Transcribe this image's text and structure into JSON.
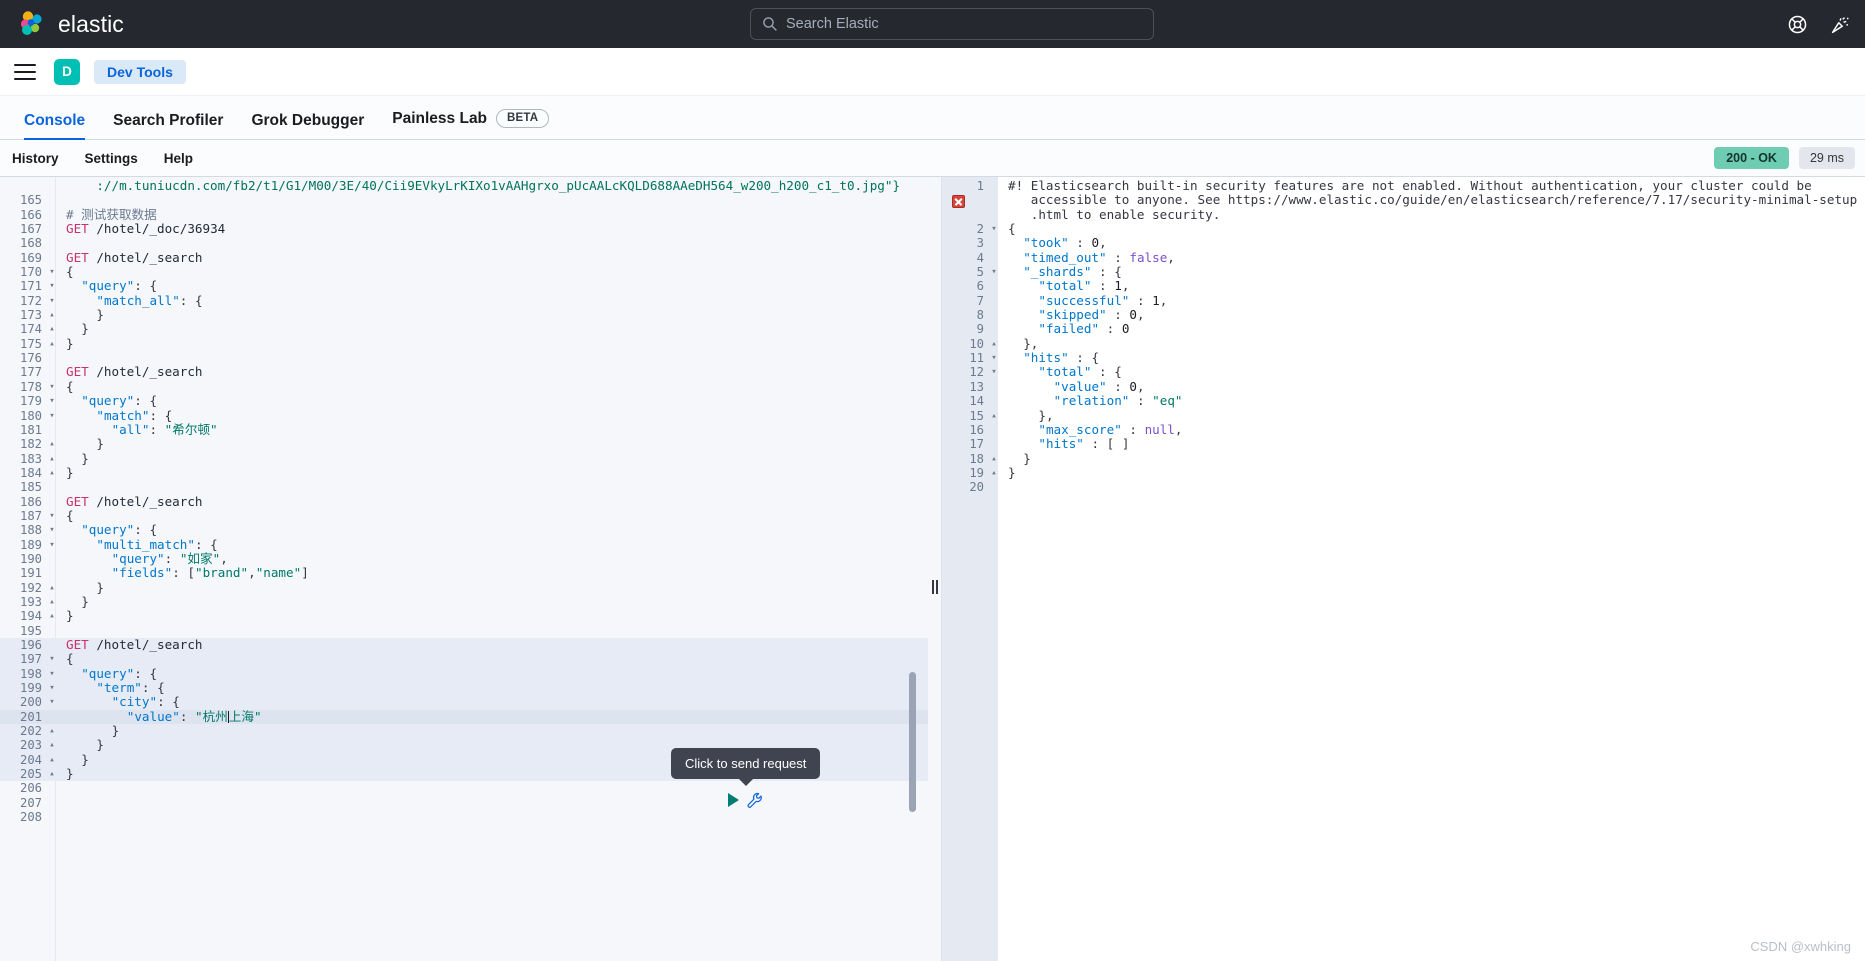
{
  "header": {
    "brand": "elastic",
    "brand_logo_icon": "elastic-logo-icon",
    "search": {
      "placeholder": "Search Elastic",
      "value": "",
      "icon": "search-icon"
    },
    "actions": [
      {
        "name": "help-icon",
        "label": "Help"
      },
      {
        "name": "announcements-icon",
        "label": "Announcements"
      }
    ],
    "colors": {
      "background": "#25282f",
      "text": "#ffffff"
    }
  },
  "breadcrumb": {
    "menu_icon": "hamburger-menu-icon",
    "space_avatar": "D",
    "crumb": "Dev Tools"
  },
  "tabs": [
    {
      "label": "Console",
      "active": true,
      "badge": ""
    },
    {
      "label": "Search Profiler",
      "active": false,
      "badge": ""
    },
    {
      "label": "Grok Debugger",
      "active": false,
      "badge": ""
    },
    {
      "label": "Painless Lab",
      "active": false,
      "badge": "BETA"
    }
  ],
  "console_toolbar": {
    "links": [
      "History",
      "Settings",
      "Help"
    ],
    "status_ok": "200 - OK",
    "status_time": "29 ms",
    "status_ok_color": "#6dccb1",
    "status_time_color": "#e3e6ed"
  },
  "editor": {
    "run_tooltip": "Click to send request",
    "play_icon": "play-triangle-icon",
    "wrench_icon": "wrench-icon",
    "active_block_start": 196,
    "active_block_end": 205,
    "cursor_line": 201,
    "lines": [
      {
        "n": "",
        "fold": "",
        "text": "    ://m.tuniucdn.com/fb2/t1/G1/M00/3E/40/Cii9EVkyLrKIXo1vAAHgrxo_pUcAALcKQLD688AAeDH564_w200_h200_c1_t0.jpg\"}",
        "kind": "string-cont"
      },
      {
        "n": "165",
        "fold": "",
        "text": "",
        "kind": "blank"
      },
      {
        "n": "166",
        "fold": "",
        "text": "# 测试获取数据",
        "kind": "comment"
      },
      {
        "n": "167",
        "fold": "",
        "text": "GET /hotel/_doc/36934",
        "kind": "request"
      },
      {
        "n": "168",
        "fold": "",
        "text": "",
        "kind": "blank"
      },
      {
        "n": "169",
        "fold": "",
        "text": "GET /hotel/_search",
        "kind": "request"
      },
      {
        "n": "170",
        "fold": "▾",
        "text": "{",
        "kind": "punct"
      },
      {
        "n": "171",
        "fold": "▾",
        "text": "  \"query\": {",
        "kind": "keyline"
      },
      {
        "n": "172",
        "fold": "▾",
        "text": "    \"match_all\": {",
        "kind": "keyline"
      },
      {
        "n": "173",
        "fold": "▴",
        "text": "    }",
        "kind": "punct"
      },
      {
        "n": "174",
        "fold": "▴",
        "text": "  }",
        "kind": "punct"
      },
      {
        "n": "175",
        "fold": "▴",
        "text": "}",
        "kind": "punct"
      },
      {
        "n": "176",
        "fold": "",
        "text": "",
        "kind": "blank"
      },
      {
        "n": "177",
        "fold": "",
        "text": "GET /hotel/_search",
        "kind": "request"
      },
      {
        "n": "178",
        "fold": "▾",
        "text": "{",
        "kind": "punct"
      },
      {
        "n": "179",
        "fold": "▾",
        "text": "  \"query\": {",
        "kind": "keyline"
      },
      {
        "n": "180",
        "fold": "▾",
        "text": "    \"match\": {",
        "kind": "keyline"
      },
      {
        "n": "181",
        "fold": "",
        "text": "      \"all\": \"希尔顿\"",
        "kind": "keyval"
      },
      {
        "n": "182",
        "fold": "▴",
        "text": "    }",
        "kind": "punct"
      },
      {
        "n": "183",
        "fold": "▴",
        "text": "  }",
        "kind": "punct"
      },
      {
        "n": "184",
        "fold": "▴",
        "text": "}",
        "kind": "punct"
      },
      {
        "n": "185",
        "fold": "",
        "text": "",
        "kind": "blank"
      },
      {
        "n": "186",
        "fold": "",
        "text": "GET /hotel/_search",
        "kind": "request"
      },
      {
        "n": "187",
        "fold": "▾",
        "text": "{",
        "kind": "punct"
      },
      {
        "n": "188",
        "fold": "▾",
        "text": "  \"query\": {",
        "kind": "keyline"
      },
      {
        "n": "189",
        "fold": "▾",
        "text": "    \"multi_match\": {",
        "kind": "keyline"
      },
      {
        "n": "190",
        "fold": "",
        "text": "      \"query\": \"如家\",",
        "kind": "keyval"
      },
      {
        "n": "191",
        "fold": "",
        "text": "      \"fields\": [\"brand\",\"name\"]",
        "kind": "keyval"
      },
      {
        "n": "192",
        "fold": "▴",
        "text": "    }",
        "kind": "punct"
      },
      {
        "n": "193",
        "fold": "▴",
        "text": "  }",
        "kind": "punct"
      },
      {
        "n": "194",
        "fold": "▴",
        "text": "}",
        "kind": "punct"
      },
      {
        "n": "195",
        "fold": "",
        "text": "",
        "kind": "blank"
      },
      {
        "n": "196",
        "fold": "",
        "text": "GET /hotel/_search",
        "kind": "request"
      },
      {
        "n": "197",
        "fold": "▾",
        "text": "{",
        "kind": "punct"
      },
      {
        "n": "198",
        "fold": "▾",
        "text": "  \"query\": {",
        "kind": "keyline"
      },
      {
        "n": "199",
        "fold": "▾",
        "text": "    \"term\": {",
        "kind": "keyline"
      },
      {
        "n": "200",
        "fold": "▾",
        "text": "      \"city\": {",
        "kind": "keyline"
      },
      {
        "n": "201",
        "fold": "",
        "text": "        \"value\": \"杭州上海\"",
        "kind": "keyval"
      },
      {
        "n": "202",
        "fold": "▴",
        "text": "      }",
        "kind": "punct"
      },
      {
        "n": "203",
        "fold": "▴",
        "text": "    }",
        "kind": "punct"
      },
      {
        "n": "204",
        "fold": "▴",
        "text": "  }",
        "kind": "punct"
      },
      {
        "n": "205",
        "fold": "▴",
        "text": "}",
        "kind": "punct"
      },
      {
        "n": "206",
        "fold": "",
        "text": "",
        "kind": "blank"
      },
      {
        "n": "207",
        "fold": "",
        "text": "",
        "kind": "blank"
      },
      {
        "n": "208",
        "fold": "",
        "text": "",
        "kind": "blank"
      }
    ]
  },
  "response": {
    "error_marker_icon": "error-x-icon",
    "lines": [
      {
        "n": "1",
        "fold": "",
        "text": "#! Elasticsearch built-in security features are not enabled. Without authentication, your cluster could be",
        "kind": "warn"
      },
      {
        "n": "",
        "fold": "",
        "text": "   accessible to anyone. See https://www.elastic.co/guide/en/elasticsearch/reference/7.17/security-minimal-setup",
        "kind": "warn"
      },
      {
        "n": "",
        "fold": "",
        "text": "   .html to enable security.",
        "kind": "warn"
      },
      {
        "n": "2",
        "fold": "▾",
        "text": "{",
        "kind": "punct"
      },
      {
        "n": "3",
        "fold": "",
        "text": "  \"took\" : 0,",
        "kind": "keynum"
      },
      {
        "n": "4",
        "fold": "",
        "text": "  \"timed_out\" : false,",
        "kind": "keybool"
      },
      {
        "n": "5",
        "fold": "▾",
        "text": "  \"_shards\" : {",
        "kind": "keyline"
      },
      {
        "n": "6",
        "fold": "",
        "text": "    \"total\" : 1,",
        "kind": "keynum"
      },
      {
        "n": "7",
        "fold": "",
        "text": "    \"successful\" : 1,",
        "kind": "keynum"
      },
      {
        "n": "8",
        "fold": "",
        "text": "    \"skipped\" : 0,",
        "kind": "keynum"
      },
      {
        "n": "9",
        "fold": "",
        "text": "    \"failed\" : 0",
        "kind": "keynum"
      },
      {
        "n": "10",
        "fold": "▴",
        "text": "  },",
        "kind": "punct"
      },
      {
        "n": "11",
        "fold": "▾",
        "text": "  \"hits\" : {",
        "kind": "keyline"
      },
      {
        "n": "12",
        "fold": "▾",
        "text": "    \"total\" : {",
        "kind": "keyline"
      },
      {
        "n": "13",
        "fold": "",
        "text": "      \"value\" : 0,",
        "kind": "keynum"
      },
      {
        "n": "14",
        "fold": "",
        "text": "      \"relation\" : \"eq\"",
        "kind": "keyval"
      },
      {
        "n": "15",
        "fold": "▴",
        "text": "    },",
        "kind": "punct"
      },
      {
        "n": "16",
        "fold": "",
        "text": "    \"max_score\" : null,",
        "kind": "keynull"
      },
      {
        "n": "17",
        "fold": "",
        "text": "    \"hits\" : [ ]",
        "kind": "keyline"
      },
      {
        "n": "18",
        "fold": "▴",
        "text": "  }",
        "kind": "punct"
      },
      {
        "n": "19",
        "fold": "▴",
        "text": "}",
        "kind": "punct"
      },
      {
        "n": "20",
        "fold": "",
        "text": "",
        "kind": "blank"
      }
    ]
  },
  "watermark": "CSDN @xwhking"
}
